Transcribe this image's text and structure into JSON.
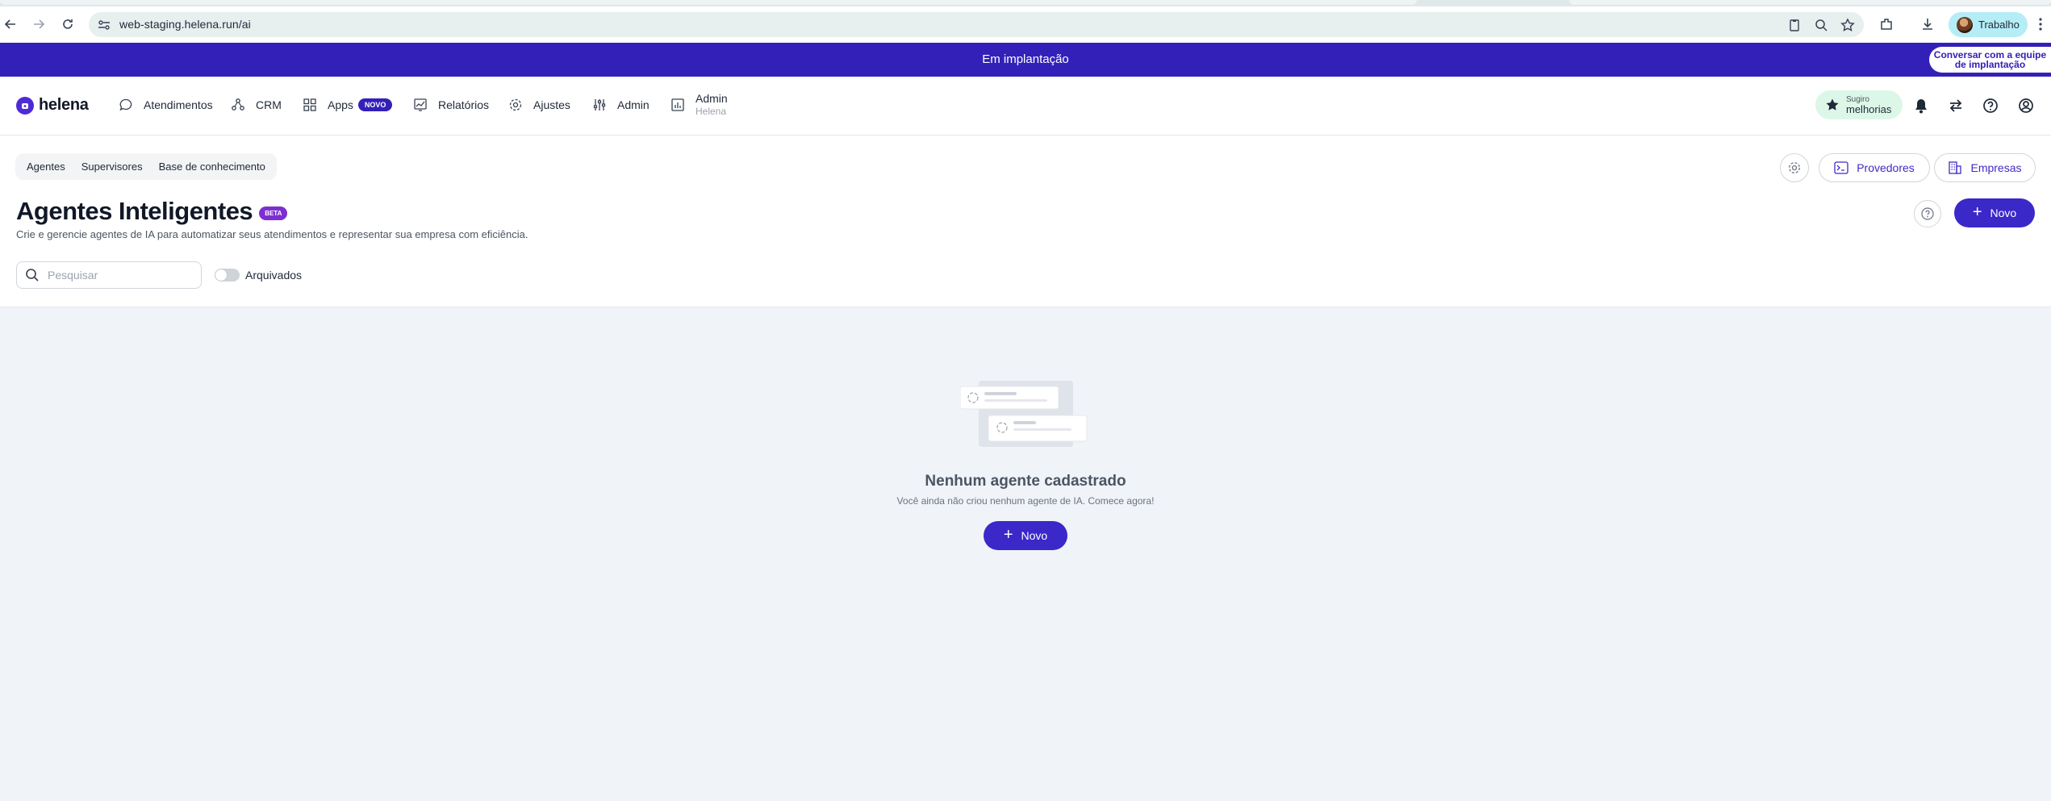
{
  "browser": {
    "url": "web-staging.helena.run/ai",
    "profile_name": "Trabalho"
  },
  "banner": {
    "text": "Em implantação",
    "button_label": "Conversar com a equipe de implantação",
    "color": "#3320b8"
  },
  "app": {
    "logo_text": "helena",
    "nav": [
      {
        "label": "Atendimentos",
        "icon": "chat-bubble-icon"
      },
      {
        "label": "CRM",
        "icon": "crm-nodes-icon"
      },
      {
        "label": "Apps",
        "icon": "grid-icon",
        "badge": "NOVO"
      },
      {
        "label": "Relatórios",
        "icon": "chart-icon"
      },
      {
        "label": "Ajustes",
        "icon": "gear-icon"
      },
      {
        "label": "Admin",
        "icon": "sliders-icon"
      },
      {
        "label": "Admin",
        "sublabel": "Helena",
        "icon": "bar-chart-icon"
      }
    ],
    "suggest": {
      "line1": "Sugiro",
      "line2": "melhorias"
    }
  },
  "page": {
    "subtabs": [
      "Agentes",
      "Supervisores",
      "Base de conhecimento"
    ],
    "providers_label": "Provedores",
    "companies_label": "Empresas",
    "title": "Agentes Inteligentes",
    "title_badge": "BETA",
    "description": "Crie e gerencie agentes de IA para automatizar seus atendimentos e representar sua empresa com eficiência.",
    "new_label": "Novo",
    "search_placeholder": "Pesquisar",
    "archived_label": "Arquivados",
    "archived_on": false
  },
  "empty_state": {
    "title": "Nenhum agente cadastrado",
    "subtitle": "Você ainda não criou nenhum agente de IA. Comece agora!",
    "button_label": "Novo"
  },
  "colors": {
    "primary": "#3a28c9",
    "accent_text": "#3f2bc4",
    "beta": "#7c2fd1",
    "suggest_bg": "#dcf7e8"
  }
}
